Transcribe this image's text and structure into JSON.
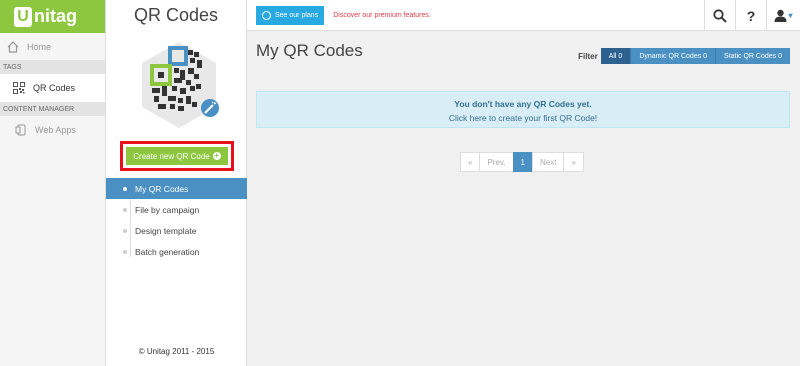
{
  "brand": {
    "logo_letter": "U",
    "logo_text": "nitag",
    "color": "#8dc63f"
  },
  "nav": {
    "home": "Home",
    "section_tags": "TAGS",
    "qr_codes": "QR Codes",
    "section_content": "CONTENT MANAGER",
    "web_apps": "Web Apps"
  },
  "mid": {
    "title": "QR Codes",
    "create_label": "Create new QR Code",
    "create_icon": "+",
    "submenu": [
      {
        "label": "My QR Codes",
        "active": true
      },
      {
        "label": "File by campaign"
      },
      {
        "label": "Design template"
      },
      {
        "label": "Batch generation"
      }
    ],
    "copyright": "© Unitag 2011 - 2015"
  },
  "topbar": {
    "plans_label": "See our plans",
    "premium_text": "Discover our premium features.",
    "help_icon": "?",
    "user_caret": "▾"
  },
  "main": {
    "title": "My QR Codes",
    "filter_label": "Filter",
    "filters": [
      {
        "label": "All 0",
        "active": true
      },
      {
        "label": "Dynamic QR Codes 0"
      },
      {
        "label": "Static QR Codes 0"
      }
    ],
    "empty_title": "You don't have any QR Codes yet.",
    "empty_link": "Click here to create your first QR Code!",
    "pager": {
      "first": "«",
      "prev": "Prev.",
      "current": "1",
      "next": "Next",
      "last": "»"
    }
  },
  "colors": {
    "accent": "#4a90c2",
    "highlight": "#e5121b",
    "info_bg": "#d9edf7"
  }
}
